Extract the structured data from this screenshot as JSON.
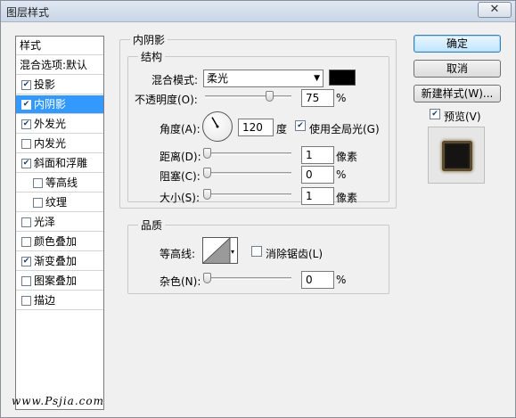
{
  "window": {
    "title": "图层样式",
    "close_glyph": "✕"
  },
  "style_list": {
    "items": [
      {
        "label": "样式",
        "checkbox": false,
        "checked": false,
        "indent": false,
        "selected": false
      },
      {
        "label": "混合选项:默认",
        "checkbox": false,
        "checked": false,
        "indent": false,
        "selected": false
      },
      {
        "label": "投影",
        "checkbox": true,
        "checked": true,
        "indent": false,
        "selected": false
      },
      {
        "label": "内阴影",
        "checkbox": true,
        "checked": true,
        "indent": false,
        "selected": true
      },
      {
        "label": "外发光",
        "checkbox": true,
        "checked": true,
        "indent": false,
        "selected": false
      },
      {
        "label": "内发光",
        "checkbox": true,
        "checked": false,
        "indent": false,
        "selected": false
      },
      {
        "label": "斜面和浮雕",
        "checkbox": true,
        "checked": true,
        "indent": false,
        "selected": false
      },
      {
        "label": "等高线",
        "checkbox": true,
        "checked": false,
        "indent": true,
        "selected": false
      },
      {
        "label": "纹理",
        "checkbox": true,
        "checked": false,
        "indent": true,
        "selected": false
      },
      {
        "label": "光泽",
        "checkbox": true,
        "checked": false,
        "indent": false,
        "selected": false
      },
      {
        "label": "颜色叠加",
        "checkbox": true,
        "checked": false,
        "indent": false,
        "selected": false
      },
      {
        "label": "渐变叠加",
        "checkbox": true,
        "checked": true,
        "indent": false,
        "selected": false
      },
      {
        "label": "图案叠加",
        "checkbox": true,
        "checked": false,
        "indent": false,
        "selected": false
      },
      {
        "label": "描边",
        "checkbox": true,
        "checked": false,
        "indent": false,
        "selected": false
      }
    ],
    "check_glyph": "✔",
    "watermark": "www.Psjia.com"
  },
  "panel": {
    "title": "内阴影",
    "structure": {
      "title": "结构",
      "blend_mode_label": "混合模式:",
      "blend_mode_value": "柔光",
      "shadow_color": "#000000",
      "opacity_label": "不透明度(O):",
      "opacity_value": "75",
      "opacity_unit": "%",
      "opacity_level": 0.75,
      "angle_label": "角度(A):",
      "angle_value": "120",
      "angle_unit": "度",
      "global_light_label": "使用全局光(G)",
      "global_light_checked": true,
      "distance_label": "距离(D):",
      "distance_value": "1",
      "distance_unit": "像素",
      "choke_label": "阻塞(C):",
      "choke_value": "0",
      "choke_unit": "%",
      "size_label": "大小(S):",
      "size_value": "1",
      "size_unit": "像素"
    },
    "quality": {
      "title": "品质",
      "contour_label": "等高线:",
      "anti_alias_label": "消除锯齿(L)",
      "anti_alias_checked": false,
      "noise_label": "杂色(N):",
      "noise_value": "0",
      "noise_unit": "%"
    }
  },
  "buttons": {
    "ok": "确定",
    "cancel": "取消",
    "new_style": "新建样式(W)...",
    "preview_label": "预览(V)",
    "preview_checked": true
  }
}
